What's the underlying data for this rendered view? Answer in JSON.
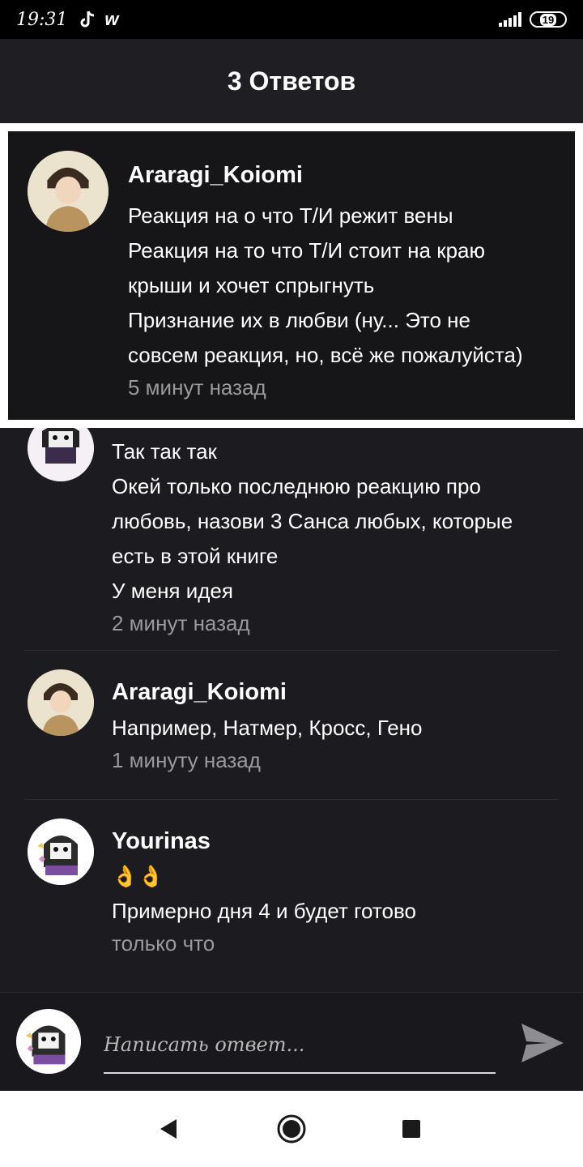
{
  "status_bar": {
    "time": "19:31",
    "app_icon": "w",
    "battery": "19"
  },
  "header": {
    "title": "3 Ответов"
  },
  "highlighted_comment": {
    "author": "Araragi_Koiomi",
    "lines": [
      "Реакция на о что Т/И режит вены",
      "Реакция на то что Т/И стоит на краю",
      "крыши и хочет спрыгнуть",
      "Признание их в любви (ну... Это не",
      "совсем реакция, но, всё же пожалуйста)"
    ],
    "time": "5 минут назад"
  },
  "replies": [
    {
      "author": "",
      "lines": [
        "Так так так",
        "Окей только последнюю реакцию про",
        "любовь, назови 3 Санса любых, которые",
        "есть в этой книге",
        "У меня идея"
      ],
      "time": "2 минут назад"
    },
    {
      "author": "Araragi_Koiomi",
      "lines": [
        "Например, Натмер, Кросс, Гено"
      ],
      "time": "1 минуту назад"
    },
    {
      "author": "Yourinas",
      "emoji": "👌👌",
      "lines": [
        "Примерно дня 4 и будет готово"
      ],
      "time": "только что"
    }
  ],
  "reply_bar": {
    "placeholder": "Написать ответ..."
  },
  "colors": {
    "background": "#1c1b1f",
    "muted_text": "#9a999e",
    "highlight_border": "#ffffff"
  },
  "icons": [
    "tiktok-icon",
    "signal-icon",
    "battery-icon",
    "send-icon",
    "back-icon",
    "home-icon",
    "recents-icon"
  ]
}
